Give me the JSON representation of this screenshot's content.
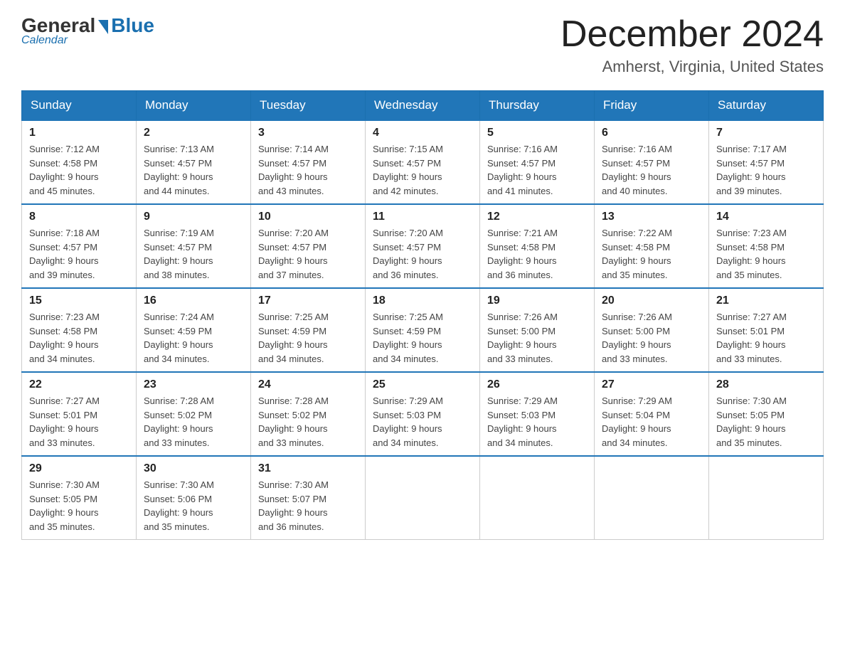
{
  "logo": {
    "general": "General",
    "blue": "Blue",
    "subtitle": "Calendar"
  },
  "header": {
    "month_title": "December 2024",
    "location": "Amherst, Virginia, United States"
  },
  "weekdays": [
    "Sunday",
    "Monday",
    "Tuesday",
    "Wednesday",
    "Thursday",
    "Friday",
    "Saturday"
  ],
  "weeks": [
    [
      {
        "day": "1",
        "sunrise": "7:12 AM",
        "sunset": "4:58 PM",
        "daylight": "9 hours and 45 minutes."
      },
      {
        "day": "2",
        "sunrise": "7:13 AM",
        "sunset": "4:57 PM",
        "daylight": "9 hours and 44 minutes."
      },
      {
        "day": "3",
        "sunrise": "7:14 AM",
        "sunset": "4:57 PM",
        "daylight": "9 hours and 43 minutes."
      },
      {
        "day": "4",
        "sunrise": "7:15 AM",
        "sunset": "4:57 PM",
        "daylight": "9 hours and 42 minutes."
      },
      {
        "day": "5",
        "sunrise": "7:16 AM",
        "sunset": "4:57 PM",
        "daylight": "9 hours and 41 minutes."
      },
      {
        "day": "6",
        "sunrise": "7:16 AM",
        "sunset": "4:57 PM",
        "daylight": "9 hours and 40 minutes."
      },
      {
        "day": "7",
        "sunrise": "7:17 AM",
        "sunset": "4:57 PM",
        "daylight": "9 hours and 39 minutes."
      }
    ],
    [
      {
        "day": "8",
        "sunrise": "7:18 AM",
        "sunset": "4:57 PM",
        "daylight": "9 hours and 39 minutes."
      },
      {
        "day": "9",
        "sunrise": "7:19 AM",
        "sunset": "4:57 PM",
        "daylight": "9 hours and 38 minutes."
      },
      {
        "day": "10",
        "sunrise": "7:20 AM",
        "sunset": "4:57 PM",
        "daylight": "9 hours and 37 minutes."
      },
      {
        "day": "11",
        "sunrise": "7:20 AM",
        "sunset": "4:57 PM",
        "daylight": "9 hours and 36 minutes."
      },
      {
        "day": "12",
        "sunrise": "7:21 AM",
        "sunset": "4:58 PM",
        "daylight": "9 hours and 36 minutes."
      },
      {
        "day": "13",
        "sunrise": "7:22 AM",
        "sunset": "4:58 PM",
        "daylight": "9 hours and 35 minutes."
      },
      {
        "day": "14",
        "sunrise": "7:23 AM",
        "sunset": "4:58 PM",
        "daylight": "9 hours and 35 minutes."
      }
    ],
    [
      {
        "day": "15",
        "sunrise": "7:23 AM",
        "sunset": "4:58 PM",
        "daylight": "9 hours and 34 minutes."
      },
      {
        "day": "16",
        "sunrise": "7:24 AM",
        "sunset": "4:59 PM",
        "daylight": "9 hours and 34 minutes."
      },
      {
        "day": "17",
        "sunrise": "7:25 AM",
        "sunset": "4:59 PM",
        "daylight": "9 hours and 34 minutes."
      },
      {
        "day": "18",
        "sunrise": "7:25 AM",
        "sunset": "4:59 PM",
        "daylight": "9 hours and 34 minutes."
      },
      {
        "day": "19",
        "sunrise": "7:26 AM",
        "sunset": "5:00 PM",
        "daylight": "9 hours and 33 minutes."
      },
      {
        "day": "20",
        "sunrise": "7:26 AM",
        "sunset": "5:00 PM",
        "daylight": "9 hours and 33 minutes."
      },
      {
        "day": "21",
        "sunrise": "7:27 AM",
        "sunset": "5:01 PM",
        "daylight": "9 hours and 33 minutes."
      }
    ],
    [
      {
        "day": "22",
        "sunrise": "7:27 AM",
        "sunset": "5:01 PM",
        "daylight": "9 hours and 33 minutes."
      },
      {
        "day": "23",
        "sunrise": "7:28 AM",
        "sunset": "5:02 PM",
        "daylight": "9 hours and 33 minutes."
      },
      {
        "day": "24",
        "sunrise": "7:28 AM",
        "sunset": "5:02 PM",
        "daylight": "9 hours and 33 minutes."
      },
      {
        "day": "25",
        "sunrise": "7:29 AM",
        "sunset": "5:03 PM",
        "daylight": "9 hours and 34 minutes."
      },
      {
        "day": "26",
        "sunrise": "7:29 AM",
        "sunset": "5:03 PM",
        "daylight": "9 hours and 34 minutes."
      },
      {
        "day": "27",
        "sunrise": "7:29 AM",
        "sunset": "5:04 PM",
        "daylight": "9 hours and 34 minutes."
      },
      {
        "day": "28",
        "sunrise": "7:30 AM",
        "sunset": "5:05 PM",
        "daylight": "9 hours and 35 minutes."
      }
    ],
    [
      {
        "day": "29",
        "sunrise": "7:30 AM",
        "sunset": "5:05 PM",
        "daylight": "9 hours and 35 minutes."
      },
      {
        "day": "30",
        "sunrise": "7:30 AM",
        "sunset": "5:06 PM",
        "daylight": "9 hours and 35 minutes."
      },
      {
        "day": "31",
        "sunrise": "7:30 AM",
        "sunset": "5:07 PM",
        "daylight": "9 hours and 36 minutes."
      },
      null,
      null,
      null,
      null
    ]
  ],
  "labels": {
    "sunrise": "Sunrise:",
    "sunset": "Sunset:",
    "daylight": "Daylight:"
  }
}
